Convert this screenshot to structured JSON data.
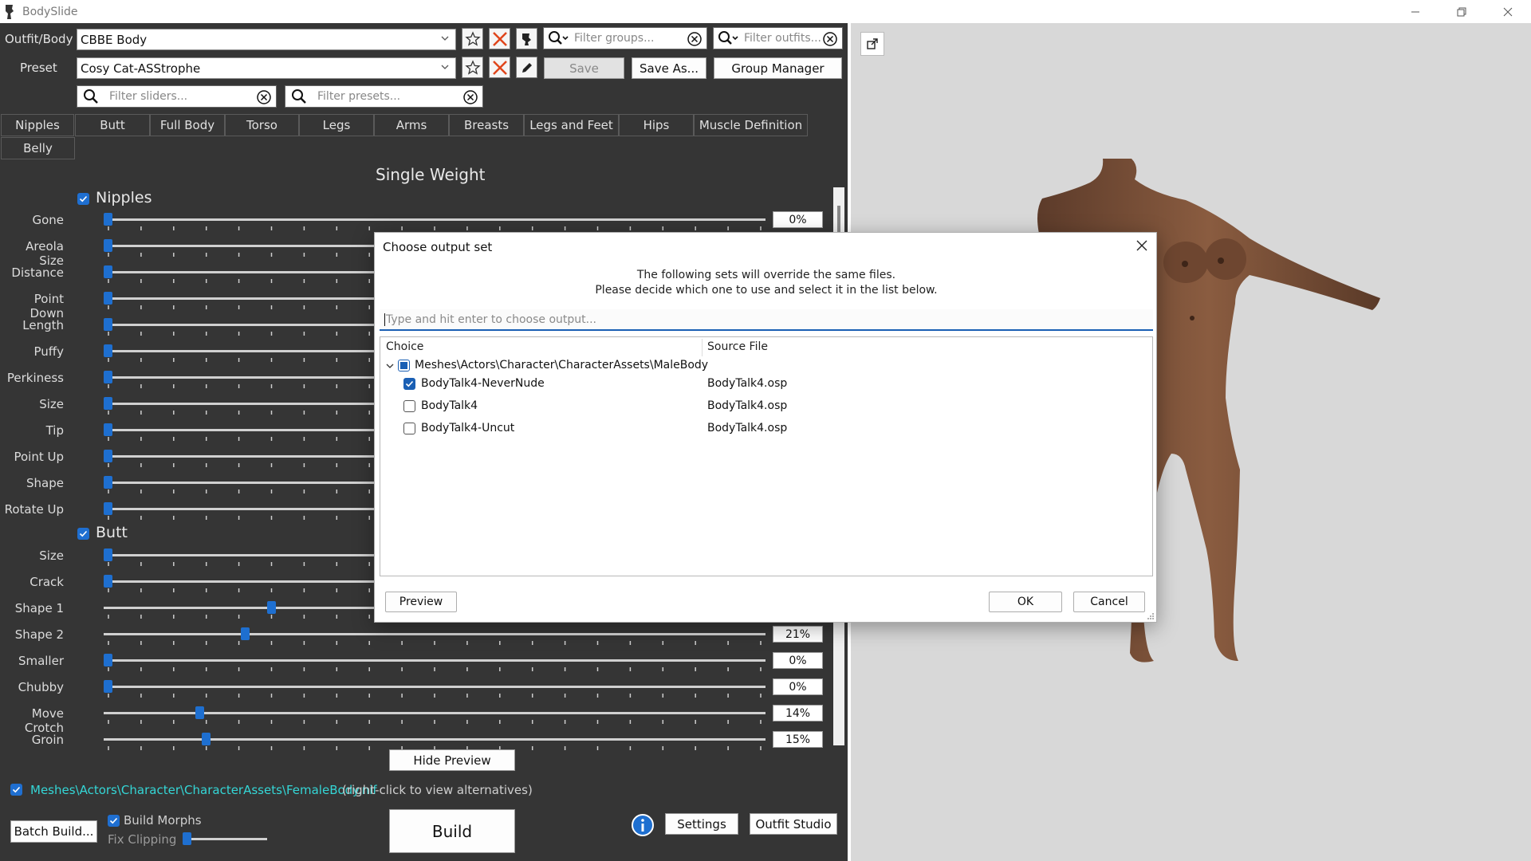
{
  "window": {
    "title": "BodySlide"
  },
  "toolbar": {
    "outfit_label": "Outfit/Body",
    "outfit_value": "CBBE Body",
    "preset_label": "Preset",
    "preset_value": "Cosy Cat-ASStrophe",
    "filter_groups_placeholder": "Filter groups...",
    "filter_outfits_placeholder": "Filter outfits...",
    "filter_sliders_placeholder": "Filter sliders...",
    "filter_presets_placeholder": "Filter presets...",
    "save_label": "Save",
    "save_as_label": "Save As...",
    "group_manager_label": "Group Manager"
  },
  "tabs": [
    "Nipples",
    "Butt",
    "Full Body",
    "Torso",
    "Legs",
    "Arms",
    "Breasts",
    "Legs and Feet",
    "Hips",
    "Muscle Definition",
    "Belly"
  ],
  "weight_title": "Single Weight",
  "sections": {
    "nipples": {
      "title": "Nipples",
      "sliders": [
        {
          "label": "Gone",
          "value": 0,
          "display": "0%"
        },
        {
          "label": "Areola Size",
          "value": 0
        },
        {
          "label": "Distance",
          "value": 0
        },
        {
          "label": "Point Down",
          "value": 0
        },
        {
          "label": "Length",
          "value": 0
        },
        {
          "label": "Puffy",
          "value": 0
        },
        {
          "label": "Perkiness",
          "value": 0
        },
        {
          "label": "Size",
          "value": 0
        },
        {
          "label": "Tip",
          "value": 0
        },
        {
          "label": "Point Up",
          "value": 0
        },
        {
          "label": "Shape",
          "value": 0
        },
        {
          "label": "Rotate Up",
          "value": 0
        }
      ]
    },
    "butt": {
      "title": "Butt",
      "sliders": [
        {
          "label": "Size",
          "value": 0
        },
        {
          "label": "Crack",
          "value": 0
        },
        {
          "label": "Shape 1",
          "value": 25
        },
        {
          "label": "Shape 2",
          "value": 21,
          "display": "21%"
        },
        {
          "label": "Smaller",
          "value": 0,
          "display": "0%"
        },
        {
          "label": "Chubby",
          "value": 0,
          "display": "0%"
        },
        {
          "label": "Move Crotch",
          "value": 14,
          "display": "14%"
        },
        {
          "label": "Groin",
          "value": 15,
          "display": "15%"
        }
      ]
    }
  },
  "bottom": {
    "hide_preview_label": "Hide Preview",
    "output_path": "Meshes\\Actors\\Character\\CharacterAssets\\FemaleBody.nif",
    "output_note": "(right-click to view alternatives)",
    "batch_build_label": "Batch Build...",
    "build_morphs_label": "Build Morphs",
    "fix_clipping_label": "Fix Clipping",
    "build_label": "Build",
    "settings_label": "Settings",
    "outfit_studio_label": "Outfit Studio"
  },
  "dialog": {
    "title": "Choose output set",
    "message_line1": "The following sets will override the same files.",
    "message_line2": "Please decide which one to use and select it in the list below.",
    "input_placeholder": "Type and hit enter to choose output...",
    "col_choice": "Choice",
    "col_source": "Source File",
    "group_label": "Meshes\\Actors\\Character\\CharacterAssets\\MaleBody",
    "items": [
      {
        "choice": "BodyTalk4-NeverNude",
        "source": "BodyTalk4.osp",
        "checked": true
      },
      {
        "choice": "BodyTalk4",
        "source": "BodyTalk4.osp",
        "checked": false
      },
      {
        "choice": "BodyTalk4-Uncut",
        "source": "BodyTalk4.osp",
        "checked": false
      }
    ],
    "preview_label": "Preview",
    "ok_label": "OK",
    "cancel_label": "Cancel"
  },
  "colors": {
    "accent": "#1e6fd0",
    "link": "#34d6d6",
    "panel": "#353535",
    "preview_bg": "#d8d8d8"
  }
}
